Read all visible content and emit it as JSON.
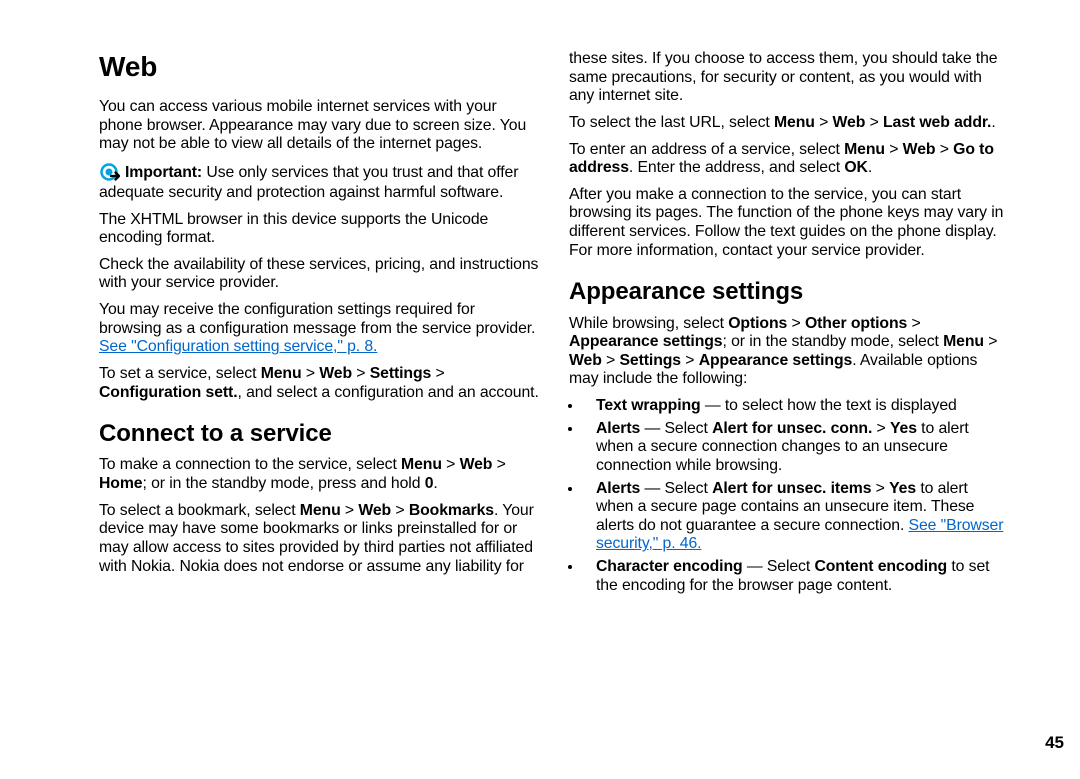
{
  "page_number": "45",
  "title": "Web",
  "col1": {
    "p1": "You can access various mobile internet services with your phone browser. Appearance may vary due to screen size. You may not be able to view all details of the internet pages.",
    "important_label": "Important:",
    "important_text": "  Use only services that you trust and that offer adequate security and protection against harmful software.",
    "p3": "The XHTML browser in this device supports the Unicode encoding format.",
    "p4": "Check the availability of these services, pricing, and instructions with your service provider.",
    "p5_a": "You may receive the configuration settings required for browsing as a configuration message from the service provider. ",
    "p5_link": "See \"Configuration setting service,\" p. 8.",
    "p6_a": "To set a service, select ",
    "p6_b": "Menu",
    "p6_c": " > ",
    "p6_d": "Web",
    "p6_e": " > ",
    "p6_f": "Settings",
    "p6_g": " > ",
    "p6_h": "Configuration sett.",
    "p6_i": ", and select a configuration and an account.",
    "h2_connect": "Connect to a service",
    "p7_a": "To make a connection to the service, select ",
    "p7_b": "Menu",
    "p7_c": " > ",
    "p7_d": "Web",
    "p7_e": " > ",
    "p7_f": "Home",
    "p7_g": "; or in the standby mode, press and hold ",
    "p7_h": "0",
    "p7_i": ".",
    "p8_a": "To select a bookmark, select ",
    "p8_b": "Menu",
    "p8_c": " > ",
    "p8_d": "Web",
    "p8_e": " > ",
    "p8_f": "Bookmarks",
    "p8_g": ". Your device may have some bookmarks or links preinstalled for or may allow access to sites provided by third parties not affiliated with Nokia. Nokia does not endorse or assume any liability for"
  },
  "col2": {
    "p1": "these sites. If you choose to access them, you should take the same precautions, for security or content, as you would with any internet site.",
    "p2_a": "To select the last URL, select ",
    "p2_b": "Menu",
    "p2_c": " > ",
    "p2_d": "Web",
    "p2_e": " > ",
    "p2_f": "Last web addr.",
    "p2_g": ".",
    "p3_a": "To enter an address of a service, select ",
    "p3_b": "Menu",
    "p3_c": " > ",
    "p3_d": "Web",
    "p3_e": " > ",
    "p3_f": "Go to address",
    "p3_g": ". Enter the address, and select ",
    "p3_h": "OK",
    "p3_i": ".",
    "p4": "After you make a connection to the service, you can start browsing its pages. The function of the phone keys may vary in different services. Follow the text guides on the phone display. For more information, contact your service provider.",
    "h2_appearance": "Appearance settings",
    "p5_a": "While browsing, select ",
    "p5_b": "Options",
    "p5_c": " > ",
    "p5_d": "Other options",
    "p5_e": " > ",
    "p5_f": "Appearance settings",
    "p5_g": "; or in the standby mode, select ",
    "p5_h": "Menu",
    "p5_i": " > ",
    "p5_j": "Web",
    "p5_k": " > ",
    "p5_l": "Settings",
    "p5_m": " > ",
    "p5_n": "Appearance settings",
    "p5_o": ". Available options may include the following:",
    "b1_a": "Text wrapping",
    "b1_b": "  — to select how the text is displayed",
    "b2_a": "Alerts",
    "b2_b": "  — Select ",
    "b2_c": "Alert for unsec. conn.",
    "b2_d": " > ",
    "b2_e": "Yes",
    "b2_f": " to alert when a secure connection changes to an unsecure connection while browsing.",
    "b3_a": "Alerts",
    "b3_b": "  — Select ",
    "b3_c": "Alert for unsec. items",
    "b3_d": " > ",
    "b3_e": "Yes",
    "b3_f": " to alert when a secure page contains an unsecure item. These alerts do not guarantee a secure connection. ",
    "b3_link": "See \"Browser security,\" p. 46.",
    "b4_a": "Character encoding",
    "b4_b": "  — Select ",
    "b4_c": "Content encoding",
    "b4_d": " to set the encoding for the browser page content."
  }
}
